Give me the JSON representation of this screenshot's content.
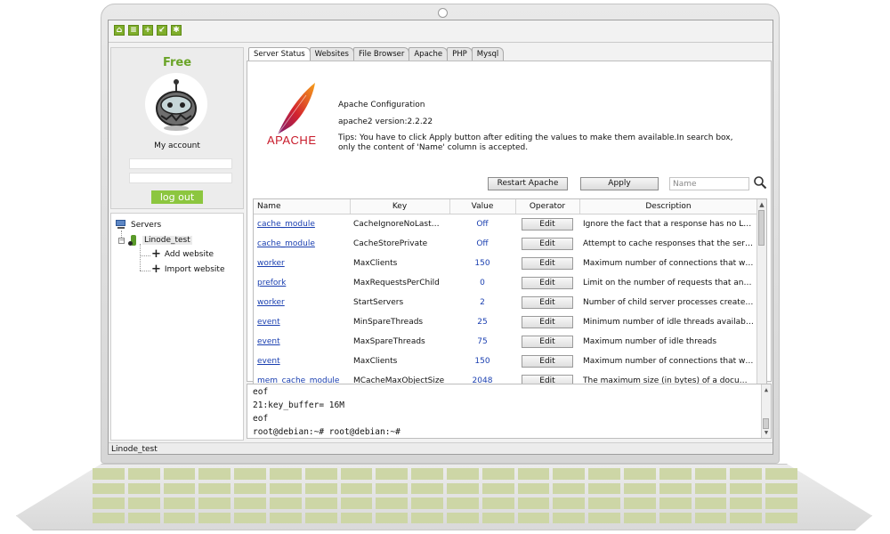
{
  "toolbar": {
    "icons": [
      "home-icon",
      "server-icon",
      "add-icon",
      "install-icon",
      "settings-icon"
    ]
  },
  "account": {
    "plan": "Free",
    "link": "My account",
    "logout_label": "log out"
  },
  "tree": {
    "root": "Servers",
    "server": "Linode_test",
    "actions": [
      "Add website",
      "Import website"
    ]
  },
  "status_bar": "Linode_test",
  "tabs": [
    "Server Status",
    "Websites",
    "File Browser",
    "Apache",
    "PHP",
    "Mysql"
  ],
  "active_tab": "Server Status",
  "apache": {
    "logo_text": "APACHE",
    "title": "Apache Configuration",
    "version": "apache2 version:2.2.22",
    "tips": "Tips: You have to click Apply button after editing the values to make them available.In search box, only the content of 'Name' column is accepted.",
    "restart_label": "Restart Apache",
    "apply_label": "Apply",
    "search_placeholder": "Name"
  },
  "table": {
    "columns": [
      "Name",
      "Key",
      "Value",
      "Operator",
      "Description"
    ],
    "edit_label": "Edit",
    "rows": [
      {
        "name": "cache_module",
        "key": "CacheIgnoreNoLastMod",
        "value": "Off",
        "desc": "Ignore the fact that a response has no Last ..."
      },
      {
        "name": "cache_module",
        "key": "CacheStorePrivate",
        "value": "Off",
        "desc": "Attempt to cache responses that the server..."
      },
      {
        "name": "worker",
        "key": "MaxClients",
        "value": "150",
        "desc": "Maximum number of connections that will be..."
      },
      {
        "name": "prefork",
        "key": "MaxRequestsPerChild",
        "value": "0",
        "desc": "Limit on the number of requests that an indi..."
      },
      {
        "name": "worker",
        "key": "StartServers",
        "value": "2",
        "desc": "Number of child server processes created at ..."
      },
      {
        "name": "event",
        "key": "MinSpareThreads",
        "value": "25",
        "desc": "Minimum number of idle threads available to ..."
      },
      {
        "name": "event",
        "key": "MaxSpareThreads",
        "value": "75",
        "desc": "Maximum number of idle threads"
      },
      {
        "name": "event",
        "key": "MaxClients",
        "value": "150",
        "desc": "Maximum number of connections that will be..."
      },
      {
        "name": "mem_cache_module",
        "key": "MCacheMaxObjectSize",
        "value": "2048",
        "desc": "The maximum size (in bytes) of a document ..."
      }
    ]
  },
  "console": {
    "lines": [
      "eof",
      "21:key_buffer= 16M",
      "eof",
      "root@debian:~# root@debian:~#"
    ]
  }
}
